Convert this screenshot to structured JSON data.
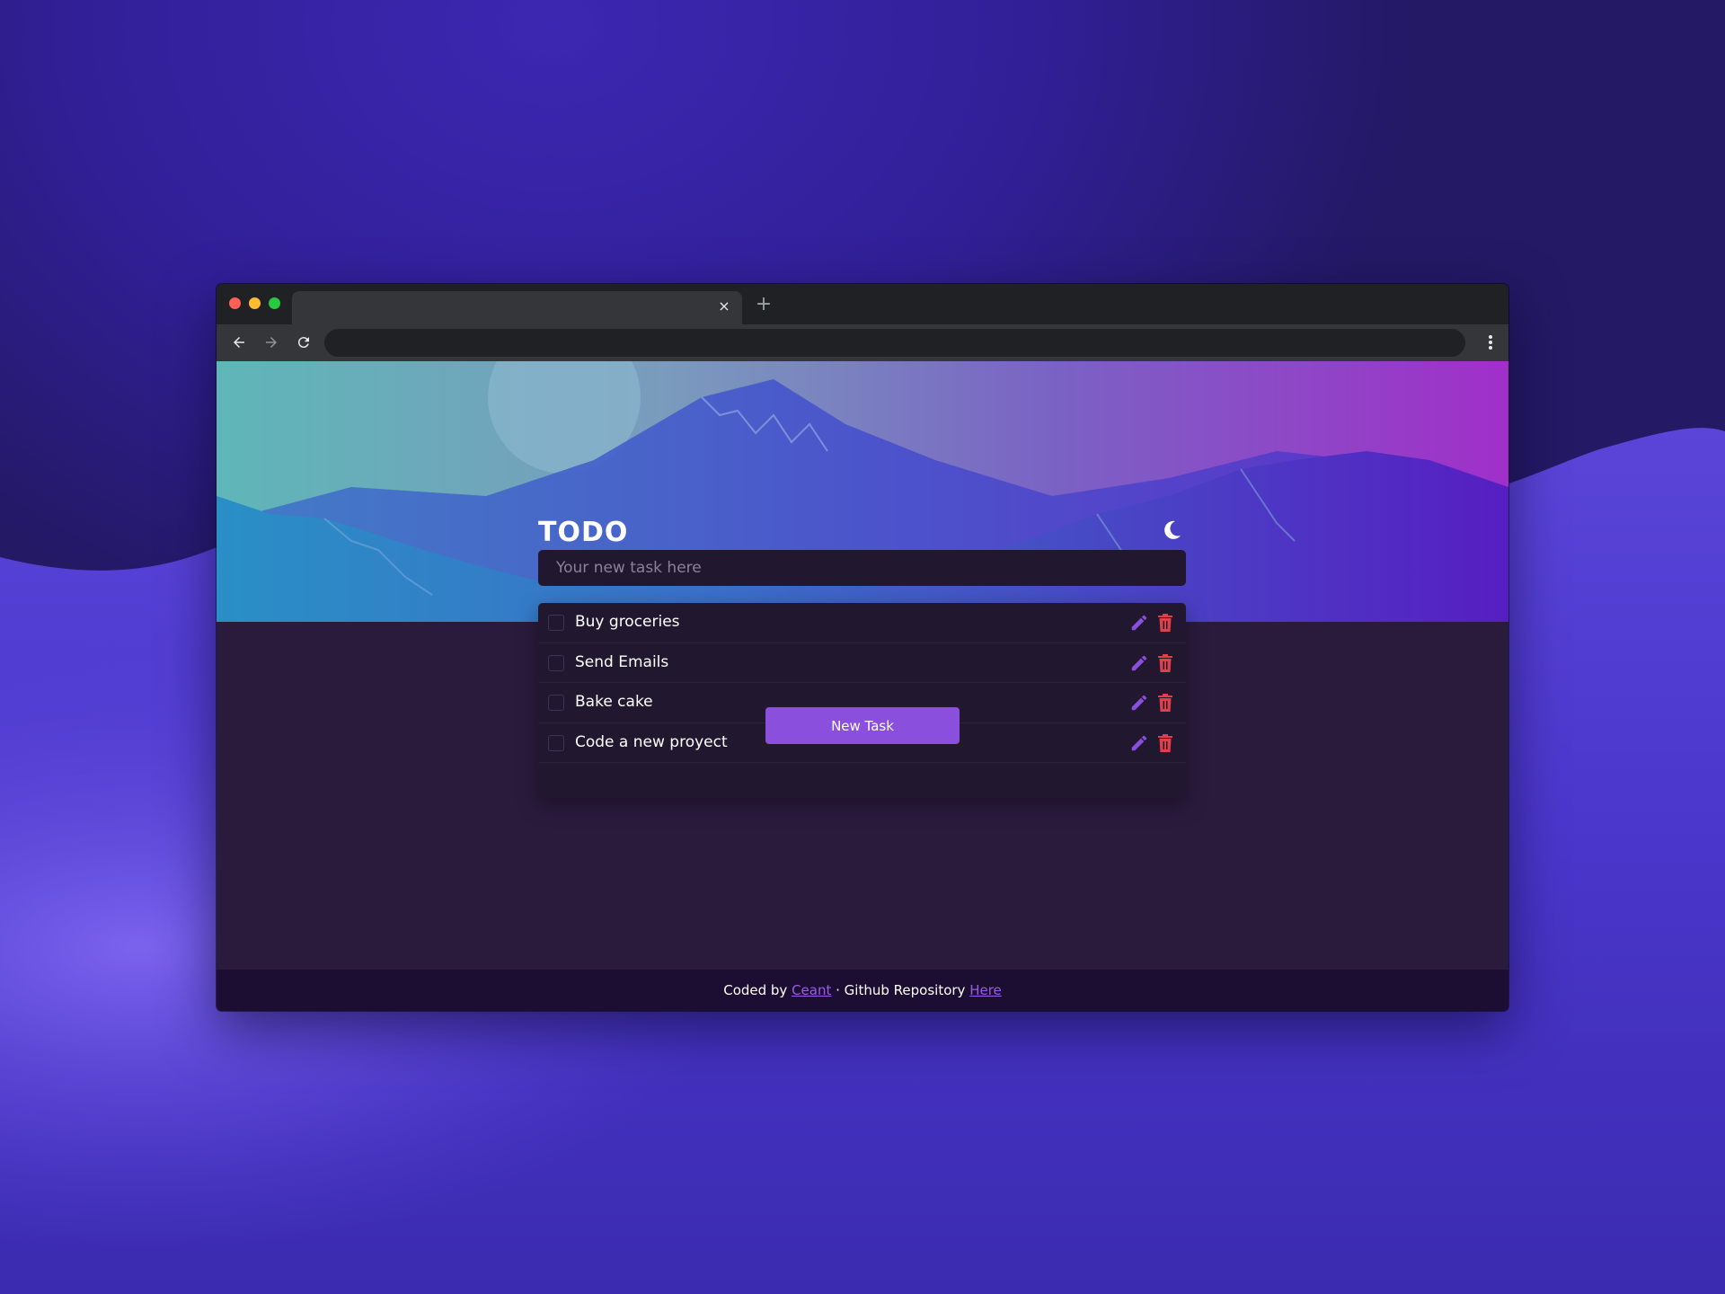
{
  "browser": {
    "tab_close_glyph": "×",
    "new_tab_glyph": "+"
  },
  "app": {
    "title": "TODO",
    "input_placeholder": "Your new task here",
    "tasks": [
      {
        "text": "Buy groceries",
        "done": false
      },
      {
        "text": "Send Emails",
        "done": false
      },
      {
        "text": "Bake cake",
        "done": false
      },
      {
        "text": "Code a new proyect",
        "done": false
      }
    ],
    "new_task_label": "New Task"
  },
  "footer": {
    "coded_by": "Coded by ",
    "author": "Ceant",
    "separator": " · Github Repository ",
    "repo_link": "Here"
  },
  "colors": {
    "accent": "#8a4fdc",
    "delete": "#e0404a",
    "page_bg": "#2a1b3d",
    "card_bg": "#211830",
    "footer_bg": "#1c0e33"
  },
  "icons": {
    "theme": "moon-icon",
    "edit": "pencil-icon",
    "delete": "trash-icon",
    "back": "arrow-left-icon",
    "forward": "arrow-right-icon",
    "reload": "reload-icon",
    "menu": "more-vertical-icon"
  }
}
